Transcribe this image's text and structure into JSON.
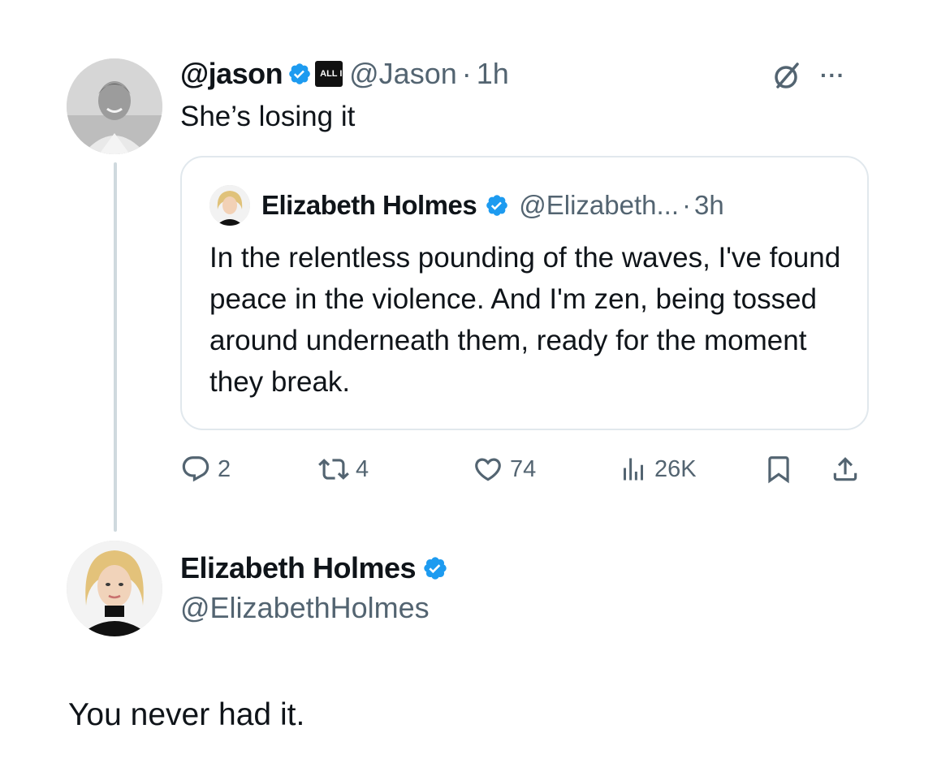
{
  "tweet": {
    "author_name": "@jason",
    "affiliate_badge": "ALL IN",
    "handle": "@Jason",
    "separator": "·",
    "time": "1h",
    "text": "She’s losing it",
    "more_label": "···"
  },
  "quote": {
    "author_name": "Elizabeth Holmes",
    "handle": "@Elizabeth...",
    "separator": "·",
    "time": "3h",
    "text": "In the relentless pounding of the waves, I've found peace in the violence. And I'm zen, being tossed around underneath them, ready for the moment they break."
  },
  "actions": {
    "replies": "2",
    "reposts": "4",
    "likes": "74",
    "views": "26K"
  },
  "profile": {
    "name": "Elizabeth Holmes",
    "handle": "@ElizabethHolmes"
  },
  "reply": {
    "text": "You never had it."
  },
  "colors": {
    "verified": "#1d9bf0",
    "secondary_text": "#536471",
    "border": "#e1e8ed"
  }
}
